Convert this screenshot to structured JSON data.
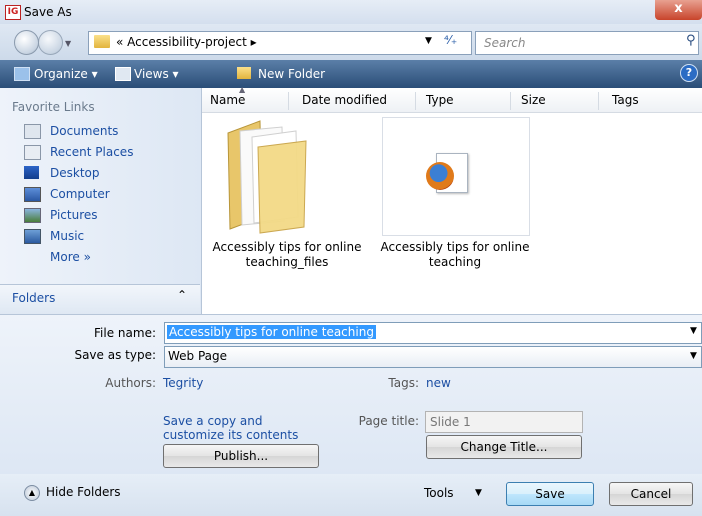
{
  "window": {
    "title": "Save As",
    "close_glyph": "x"
  },
  "address": {
    "path_prefix": "«",
    "path": "Accessibility-project",
    "path_suffix": "▸",
    "search_placeholder": "Search"
  },
  "toolbar": {
    "organize": "Organize ▾",
    "views": "Views ▾",
    "new_folder": "New Folder",
    "help": "?"
  },
  "sidebar": {
    "favorites_title": "Favorite Links",
    "items": [
      {
        "label": "Documents",
        "icon": "documents-icon"
      },
      {
        "label": "Recent Places",
        "icon": "recent-places-icon"
      },
      {
        "label": "Desktop",
        "icon": "desktop-icon"
      },
      {
        "label": "Computer",
        "icon": "computer-icon"
      },
      {
        "label": "Pictures",
        "icon": "pictures-icon"
      },
      {
        "label": "Music",
        "icon": "music-icon"
      }
    ],
    "more": "More »",
    "folders_label": "Folders",
    "folders_chevron": "⌃"
  },
  "columns": [
    "Name",
    "Date modified",
    "Type",
    "Size",
    "Tags"
  ],
  "files": [
    {
      "name": "Accessibly tips for online teaching_files",
      "icon": "folder-icon"
    },
    {
      "name": "Accessibly tips for online teaching",
      "icon": "firefox-document-icon"
    }
  ],
  "form": {
    "file_name_label": "File name:",
    "file_name_value": "Accessibly tips for online teaching",
    "save_as_type_label": "Save as type:",
    "save_as_type_value": "Web Page",
    "authors_label": "Authors:",
    "authors_value": "Tegrity",
    "tags_label": "Tags:",
    "tags_value": "new",
    "save_copy_line1": "Save a copy and",
    "save_copy_line2": "customize its contents",
    "page_title_label": "Page title:",
    "page_title_value": "Slide 1",
    "change_title_button": "Change Title...",
    "publish_button": "Publish..."
  },
  "footer": {
    "hide_folders": "Hide Folders",
    "tools": "Tools",
    "save": "Save",
    "cancel": "Cancel"
  },
  "colors": {
    "accent": "#1c4fa3",
    "selection": "#3399ff",
    "toolbar": "#2a4d77"
  }
}
